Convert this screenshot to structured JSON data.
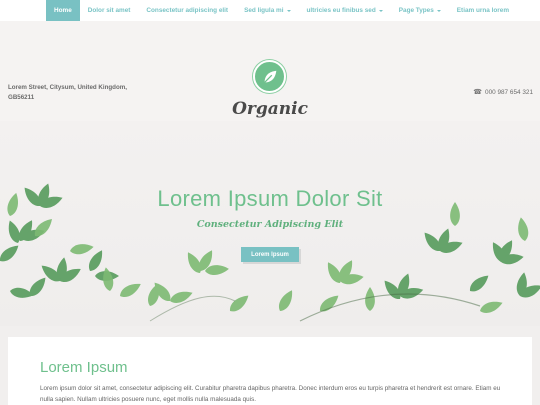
{
  "nav": {
    "items": [
      {
        "label": "Home",
        "active": true,
        "dropdown": false
      },
      {
        "label": "Dolor sit amet",
        "active": false,
        "dropdown": false
      },
      {
        "label": "Consectetur adipiscing elit",
        "active": false,
        "dropdown": false
      },
      {
        "label": "Sed ligula mi",
        "active": false,
        "dropdown": true
      },
      {
        "label": "ultricies eu finibus sed",
        "active": false,
        "dropdown": true
      },
      {
        "label": "Page Types",
        "active": false,
        "dropdown": true
      },
      {
        "label": "Etiam urna lorem",
        "active": false,
        "dropdown": false
      }
    ]
  },
  "header": {
    "address_line1": "Lorem Street, Citysum, United Kingdom,",
    "address_line2": "GB56211",
    "phone": "000 987 654 321",
    "brand": "Organic",
    "logo_icon": "leaf-icon",
    "phone_icon": "phone-icon"
  },
  "hero": {
    "title": "Lorem Ipsum Dolor Sit",
    "subtitle": "Consectetur Adipiscing Elit",
    "button_label": "Lorem Ipsum"
  },
  "content": {
    "title": "Lorem Ipsum",
    "text": "Lorem ipsum dolor sit amet, consectetur adipiscing elit. Curabitur pharetra dapibus pharetra. Donec interdum eros eu turpis pharetra et hendrerit est ornare. Etiam eu nulla sapien. Nullam ultricies posuere nunc, eget mollis nulla malesuada quis."
  },
  "colors": {
    "accent": "#79c1c3",
    "green": "#6fc08d",
    "text": "#666666"
  }
}
